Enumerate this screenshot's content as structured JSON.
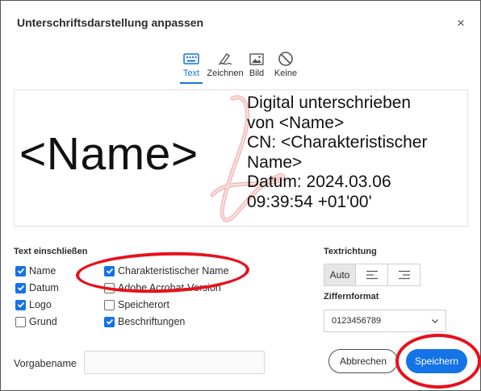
{
  "dialog": {
    "title": "Unterschriftsdarstellung anpassen",
    "close_glyph": "×"
  },
  "tabs": [
    {
      "label": "Text",
      "icon": "keyboard-icon",
      "active": true
    },
    {
      "label": "Zeichnen",
      "icon": "pen-icon",
      "active": false
    },
    {
      "label": "Bild",
      "icon": "image-icon",
      "active": false
    },
    {
      "label": "Keine",
      "icon": "none-icon",
      "active": false
    }
  ],
  "preview": {
    "name": "<Name>",
    "details": "Digital unterschrieben\nvon <Name>\nCN: <Charakteristischer\nName>\nDatum: 2024.03.06\n09:39:54 +01'00'"
  },
  "include": {
    "label": "Text einschließen",
    "items": [
      {
        "label": "Name",
        "checked": true
      },
      {
        "label": "Datum",
        "checked": true
      },
      {
        "label": "Logo",
        "checked": true
      },
      {
        "label": "Grund",
        "checked": false
      },
      {
        "label": "Charakteristischer Name",
        "checked": true
      },
      {
        "label": "Adobe Acrobat-Version",
        "checked": false
      },
      {
        "label": "Speicherort",
        "checked": false
      },
      {
        "label": "Beschriftungen",
        "checked": true
      }
    ]
  },
  "direction": {
    "label": "Textrichtung",
    "options": [
      "Auto",
      "align-left-icon",
      "align-right-icon"
    ],
    "selected": "Auto"
  },
  "number_format": {
    "label": "Ziffernformat",
    "value": "0123456789"
  },
  "default_name": {
    "label": "Vorgabename",
    "value": ""
  },
  "buttons": {
    "cancel": "Abbrechen",
    "save": "Speichern"
  },
  "colors": {
    "accent": "#1473e6",
    "annotation": "#e8101a"
  }
}
